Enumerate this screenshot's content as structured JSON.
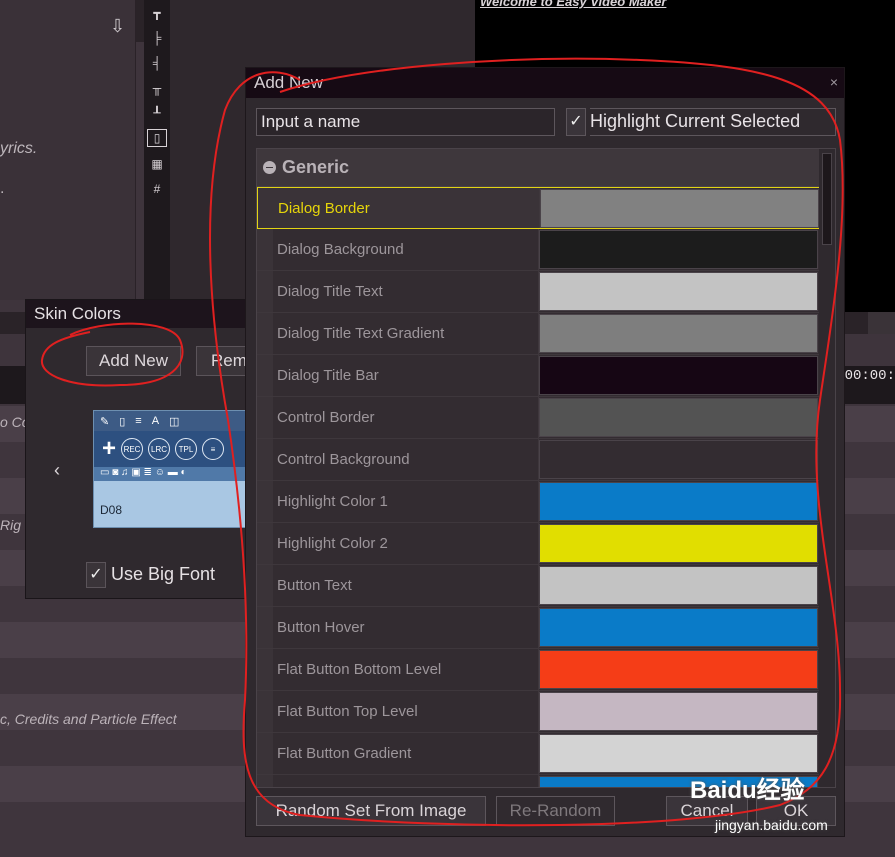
{
  "background": {
    "lyrics_text": "yrics.",
    "dot_text": ".",
    "welcome_text": "Welcome to Easy Video Maker",
    "timecode": "00:00:",
    "track_texts": [
      "o Co",
      "Rig",
      "c, Credits and Particle Effect"
    ],
    "download_icon": "download-icon",
    "toolbar_icons": [
      "align-top-icon",
      "align-left-icon",
      "align-right-icon",
      "align-center-icon",
      "align-bottom-icon",
      "fit-frame-icon",
      "grid-icon",
      "grid-small-icon"
    ]
  },
  "skin_colors": {
    "title": "Skin Colors",
    "add_new_label": "Add New",
    "remove_label": "Rem",
    "prev_arrow": "‹",
    "preview_label": "D08",
    "preview_buttons": [
      "REC",
      "LRC",
      "TPL"
    ],
    "use_big_font_label": "Use Big Font",
    "use_big_font_checked": true
  },
  "dialog": {
    "title": "Add New",
    "close_glyph": "×",
    "name_input_value": "Input a name",
    "highlight_label": "Highlight Current Selected",
    "highlight_checked": true,
    "group_name": "Generic",
    "selected_index": 0,
    "rows": [
      {
        "label": "Dialog Border",
        "color": "#818181"
      },
      {
        "label": "Dialog Background",
        "color": "#1c1c1c"
      },
      {
        "label": "Dialog Title Text",
        "color": "#c3c3c3"
      },
      {
        "label": "Dialog Title Text Gradient",
        "color": "#7e7e7e"
      },
      {
        "label": "Dialog Title Bar",
        "color": "#160614"
      },
      {
        "label": "Control Border",
        "color": "#535353"
      },
      {
        "label": "Control Background",
        "color": "#332c31"
      },
      {
        "label": "Highlight Color 1",
        "color": "#0a7bc8"
      },
      {
        "label": "Highlight Color 2",
        "color": "#e1de00"
      },
      {
        "label": "Button Text",
        "color": "#c3c3c3"
      },
      {
        "label": "Button Hover",
        "color": "#0a7bc8"
      },
      {
        "label": "Flat Button Bottom Level",
        "color": "#f53d17"
      },
      {
        "label": "Flat Button Top Level",
        "color": "#c5b7c2"
      },
      {
        "label": "Flat Button Gradient",
        "color": "#d3d3d3"
      },
      {
        "label": "",
        "color": "#0a7bc8"
      }
    ],
    "buttons": {
      "random_label": "Random Set From Image",
      "re_random_label": "Re-Random",
      "cancel_label": "Cancel",
      "ok_label": "OK"
    }
  },
  "watermark": {
    "brand": "Baidu经验",
    "url": "jingyan.baidu.com"
  }
}
